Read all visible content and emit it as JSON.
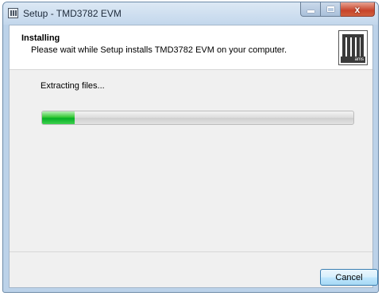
{
  "window": {
    "title": "Setup - TMD3782 EVM",
    "icon": "installer-app-icon",
    "controls": {
      "minimize_icon": "minimize-icon",
      "maximize_icon": "maximize-icon",
      "close_icon": "close-icon",
      "close_glyph": "x"
    }
  },
  "header": {
    "title": "Installing",
    "subtitle": "Please wait while Setup installs TMD3782 EVM on your computer.",
    "logo_icon": "ams-logo-icon",
    "logo_word": "ams"
  },
  "main": {
    "status_text": "Extracting files...",
    "progress_fraction": 0.105,
    "progress_color": "#06b025"
  },
  "footer": {
    "cancel_label": "Cancel"
  }
}
